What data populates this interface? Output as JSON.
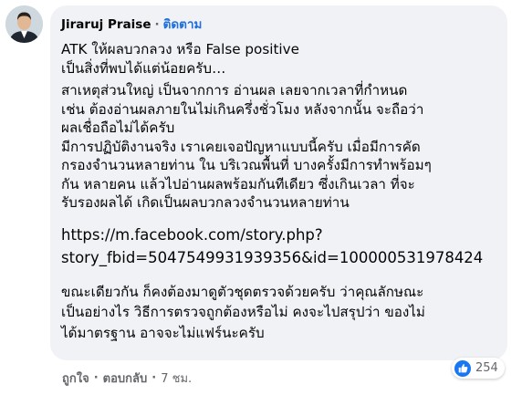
{
  "comment": {
    "author": "Jiraruj Praise",
    "follow_label": "ติดตาม",
    "separator": "·",
    "paragraphs": {
      "intro": [
        "ATK ให้ผลบวกลวง หรือ False positive",
        "เป็นสิ่งที่พบได้แต่น้อยครับ…"
      ],
      "reason": [
        "สาเหตุส่วนใหญ่ เป็นจากการ อ่านผล เลยจากเวลาที่กำหนด",
        "เช่น ต้องอ่านผลภายในไม่เกินครึ่งชั่วโมง หลังจากนั้น จะถือว่า",
        "ผลเชื่อถือไม่ได้ครับ",
        "มีการปฏิบัติงานจริง เราเคยเจอปัญหาแบบนี้ครับ เมื่อมีการคัด",
        "กรองจำนวนหลายท่าน ใน บริเวณพื้นที่ บางครั้งมีการทำพร้อมๆ",
        "กัน หลายคน แล้วไปอ่านผลพร้อมกันทีเดียว ซึ่งเกินเวลา ที่จะ",
        "รับรองผลได้ เกิดเป็นผลบวกลวงจำนวนหลายท่าน"
      ],
      "link": [
        "https://m.facebook.com/story.php?",
        "story_fbid=5047549931939356&id=100000531978424"
      ],
      "closing": [
        "ขณะเดียวกัน ก็คงต้องมาดูตัวชุดตรวจด้วยครับ ว่าคุณลักษณะ",
        "เป็นอย่างไร วิธีการตรวจถูกต้องหรือไม่ คงจะไปสรุปว่า ของไม่",
        "ได้มาตรฐาน อาจจะไม่แฟร์นะครับ"
      ]
    },
    "reactions": {
      "icon": "like-icon",
      "count": "254",
      "color": "#1877f2"
    },
    "actions": {
      "like_label": "ถูกใจ",
      "reply_label": "ตอบกลับ",
      "time": "7 ชม."
    }
  },
  "colors": {
    "bubble": "#f0f2f5",
    "follow": "#216fdb",
    "meta": "#65676b"
  }
}
